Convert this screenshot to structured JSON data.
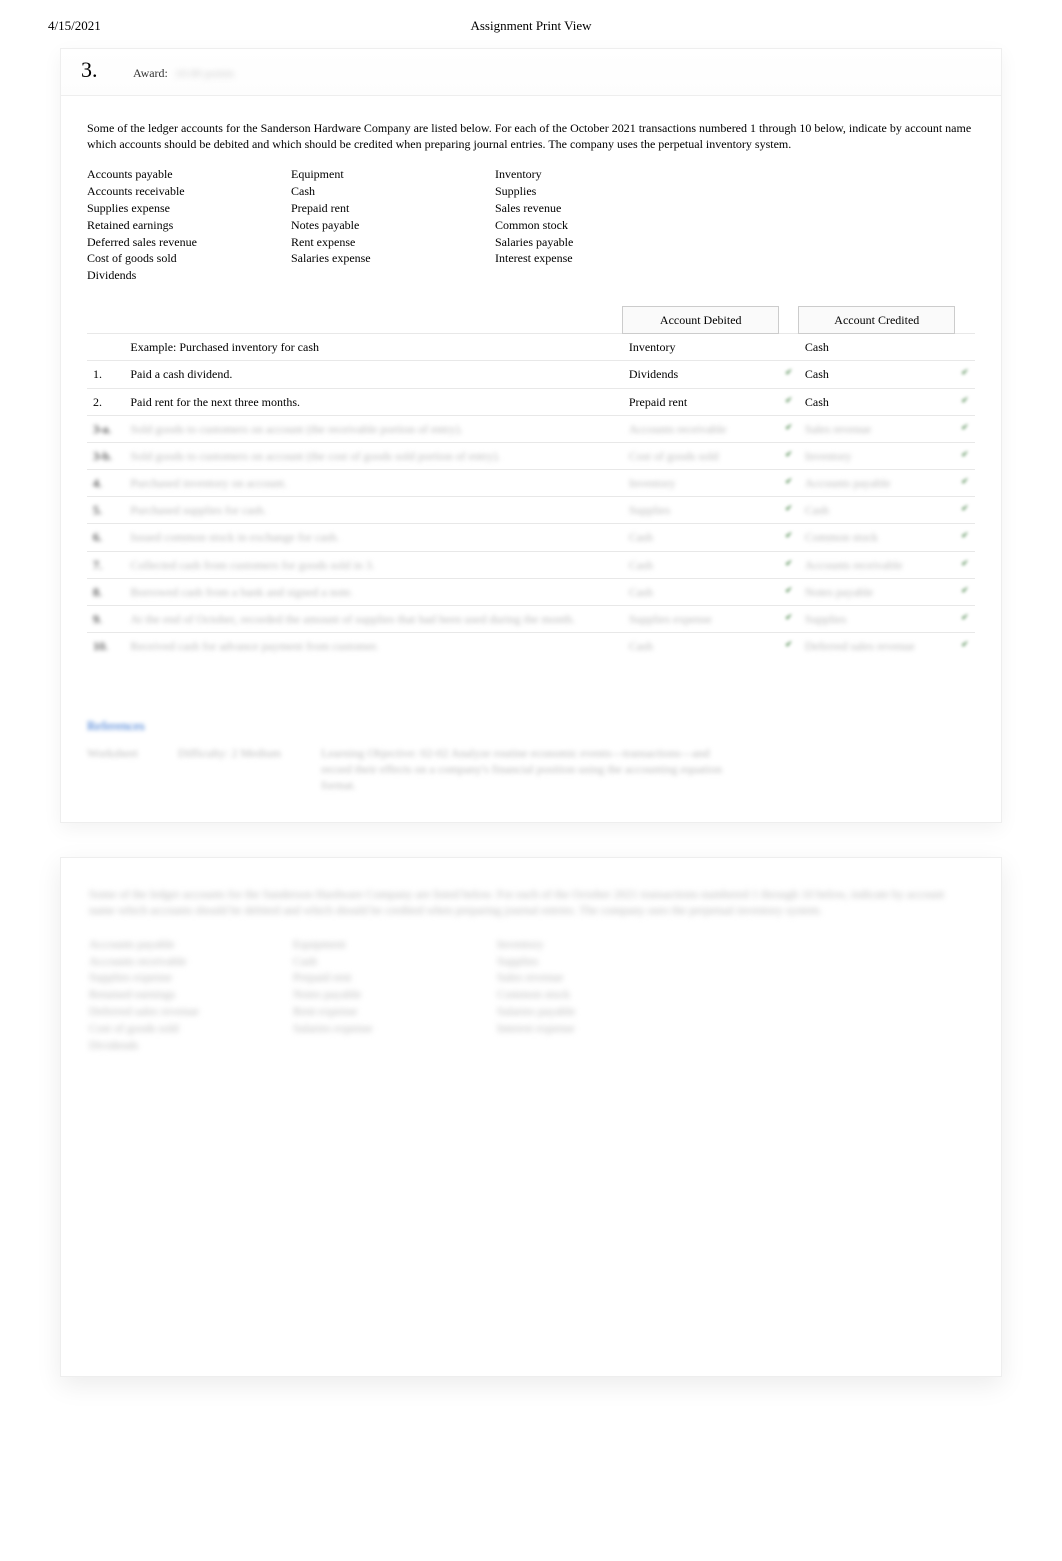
{
  "header": {
    "date": "4/15/2021",
    "title": "Assignment Print View"
  },
  "question": {
    "number": "3.",
    "award_label": "Award:",
    "award_value": "10.00 points",
    "intro": "Some of the ledger accounts for the Sanderson Hardware Company are listed below. For each of the October 2021 transactions numbered 1 through 10 below, indicate by account name which accounts should be debited and which should be credited when preparing journal entries. The company uses the perpetual inventory system.",
    "ledger_col1": [
      "Accounts payable",
      "Accounts receivable",
      "Supplies expense",
      "Retained earnings",
      "Deferred sales revenue",
      "Cost of goods sold",
      "Dividends"
    ],
    "ledger_col2": [
      "Equipment",
      "Cash",
      "Prepaid rent",
      "Notes payable",
      "Rent expense",
      "Salaries expense"
    ],
    "ledger_col3": [
      "Inventory",
      "Supplies",
      "Sales revenue",
      "Common stock",
      "Salaries payable",
      "Interest expense"
    ]
  },
  "table": {
    "head_debit": "Account Debited",
    "head_credit": "Account Credited",
    "rows": [
      {
        "n": "",
        "desc": "Example: Purchased inventory for cash",
        "d": "Inventory",
        "c": "Cash",
        "clear": true,
        "nocheck": true
      },
      {
        "n": "1.",
        "desc": "Paid a cash dividend.",
        "d": "Dividends",
        "c": "Cash",
        "clear": true
      },
      {
        "n": "2.",
        "desc": "Paid rent for the next three months.",
        "d": "Prepaid rent",
        "c": "Cash",
        "clear": true
      },
      {
        "n": "3-a.",
        "desc": "Sold goods to customers on account (the receivable portion of entry).",
        "d": "Accounts receivable",
        "c": "Sales revenue",
        "clear": false
      },
      {
        "n": "3-b.",
        "desc": "Sold goods to customers on account (the cost of goods sold portion of entry).",
        "d": "Cost of goods sold",
        "c": "Inventory",
        "clear": false
      },
      {
        "n": "4.",
        "desc": "Purchased inventory on account.",
        "d": "Inventory",
        "c": "Accounts payable",
        "clear": false
      },
      {
        "n": "5.",
        "desc": "Purchased supplies for cash.",
        "d": "Supplies",
        "c": "Cash",
        "clear": false
      },
      {
        "n": "6.",
        "desc": "Issued common stock in exchange for cash.",
        "d": "Cash",
        "c": "Common stock",
        "clear": false
      },
      {
        "n": "7.",
        "desc": "Collected cash from customers for goods sold in 3.",
        "d": "Cash",
        "c": "Accounts receivable",
        "clear": false
      },
      {
        "n": "8.",
        "desc": "Borrowed cash from a bank and signed a note.",
        "d": "Cash",
        "c": "Notes payable",
        "clear": false
      },
      {
        "n": "9.",
        "desc": "At the end of October, recorded the amount of supplies that had been used during the month.",
        "d": "Supplies expense",
        "c": "Supplies",
        "clear": false
      },
      {
        "n": "10.",
        "desc": "Received cash for advance payment from customer.",
        "d": "Cash",
        "c": "Deferred sales revenue",
        "clear": false
      }
    ]
  },
  "refs": {
    "link": "References",
    "a": "Worksheet",
    "b": "Difficulty: 2 Medium",
    "c": "Learning Objective: 02-02 Analyze routine economic events—transactions—and record their effects on a company's financial position using the accounting equation format."
  },
  "lower": {
    "intro": "Some of the ledger accounts for the Sanderson Hardware Company are listed below. For each of the October 2021 transactions numbered 1 through 10 below, indicate by account name which accounts should be debited and which should be credited when preparing journal entries. The company uses the perpetual inventory system.",
    "col1": [
      "Accounts payable",
      "Accounts receivable",
      "Supplies expense",
      "Retained earnings",
      "Deferred sales revenue",
      "Cost of goods sold",
      "Dividends"
    ],
    "col2": [
      "Equipment",
      "Cash",
      "Prepaid rent",
      "Notes payable",
      "Rent expense",
      "Salaries expense"
    ],
    "col3": [
      "Inventory",
      "Supplies",
      "Sales revenue",
      "Common stock",
      "Salaries payable",
      "Interest expense"
    ]
  }
}
